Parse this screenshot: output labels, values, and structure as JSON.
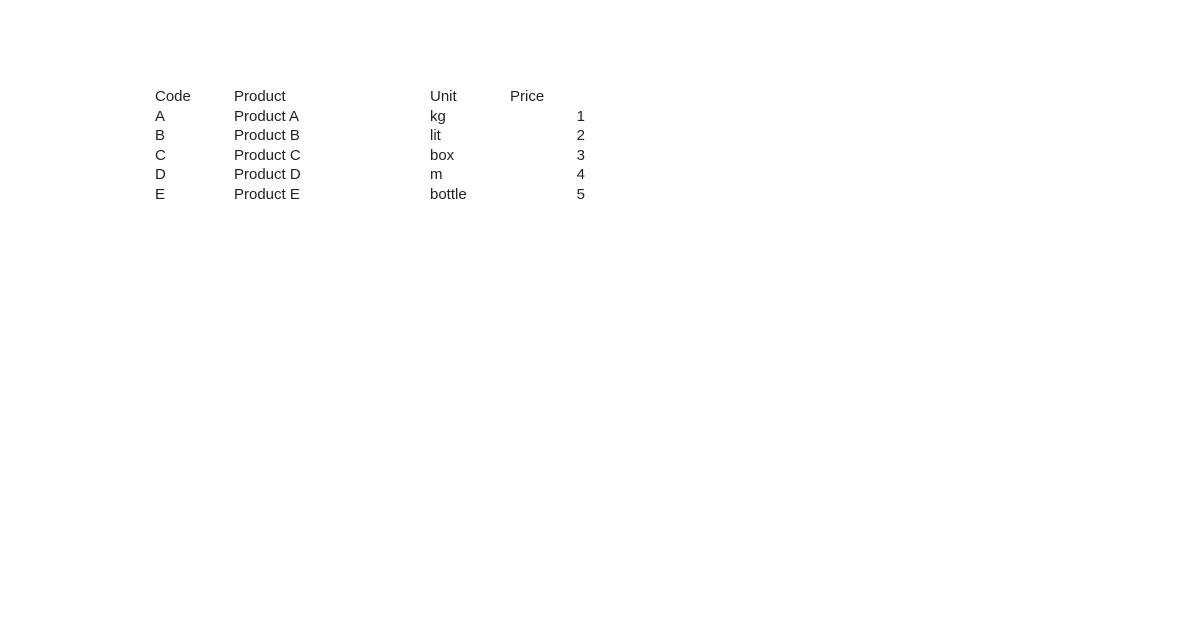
{
  "page": {
    "background_color": "#ffffff",
    "text_color": "#222222"
  },
  "table": {
    "columns": [
      {
        "key": "code",
        "label": "Code",
        "align": "left"
      },
      {
        "key": "product",
        "label": "Product",
        "align": "left"
      },
      {
        "key": "unit",
        "label": "Unit",
        "align": "left"
      },
      {
        "key": "price",
        "label": "Price",
        "align": "right"
      }
    ],
    "headers": {
      "code": "Code",
      "product": "Product",
      "unit": "Unit",
      "price": "Price"
    },
    "rows": [
      {
        "code": "A",
        "product": "Product A",
        "unit": "kg",
        "price": "1"
      },
      {
        "code": "B",
        "product": "Product B",
        "unit": "lit",
        "price": "2"
      },
      {
        "code": "C",
        "product": "Product C",
        "unit": "box",
        "price": "3"
      },
      {
        "code": "D",
        "product": "Product D",
        "unit": "m",
        "price": "4"
      },
      {
        "code": "E",
        "product": "Product E",
        "unit": "bottle",
        "price": "5"
      }
    ]
  }
}
